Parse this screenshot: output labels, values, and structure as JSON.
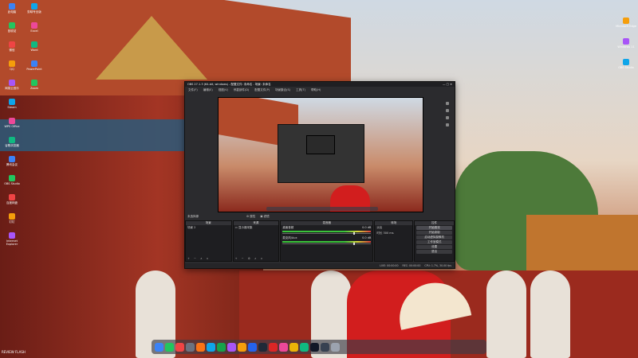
{
  "obs": {
    "title": "OBS 27.1.3 (64-bit, windows) - 配置文件: 未命名 - 场景: 未命名",
    "menu": [
      "文件(F)",
      "编辑(E)",
      "视图(V)",
      "停靠部件(D)",
      "配置文件(P)",
      "场景集合(S)",
      "工具(T)",
      "帮助(H)"
    ],
    "source_bar_label": "未选择源",
    "source_bar_props": "⚙ 属性",
    "source_bar_filters": "▣ 滤镜",
    "docks": {
      "scenes": {
        "title": "场景",
        "items": [
          "场景 2"
        ],
        "footer": "+ − ∧ ∨"
      },
      "sources": {
        "title": "来源",
        "items": [
          "显示器采集"
        ],
        "footer": "+ − ⚙ ∧ ∨"
      },
      "mixer": {
        "title": "混音器",
        "channels": [
          {
            "name": "桌面音频",
            "db": "0.0 dB",
            "level": 0.8
          },
          {
            "name": "麦克风/Aux",
            "db": "0.0 dB",
            "level": 0.8
          }
        ]
      },
      "transitions": {
        "title": "转场",
        "type": "淡出",
        "duration_label": "时长",
        "duration": "300 ms"
      },
      "controls": {
        "title": "控件",
        "buttons": [
          "开始推流",
          "开始录制",
          "启动虚拟摄像机",
          "工作室模式",
          "设置",
          "退出"
        ]
      }
    },
    "status": {
      "live": "LIVE: 00:00:00",
      "rec": "REC: 00:00:00",
      "cpu": "CPU: 1.7%, 30.00 fps"
    }
  },
  "taskbar": {
    "icons": [
      "finder-icon",
      "browser-icon",
      "chat-icon",
      "settings-icon",
      "music-icon",
      "mail-icon",
      "wechat-icon",
      "app-icon",
      "store-icon",
      "folder-icon",
      "steam-icon",
      "video-icon",
      "photo-icon",
      "calendar-icon",
      "notes-icon",
      "terminal-icon",
      "obs-icon",
      "trash-icon"
    ],
    "colors": [
      "#3b82f6",
      "#22c55e",
      "#ef4444",
      "#6b7280",
      "#f97316",
      "#0ea5e9",
      "#16a34a",
      "#a855f7",
      "#f59e0b",
      "#2563eb",
      "#1f2937",
      "#dc2626",
      "#ec4899",
      "#eab308",
      "#10b981",
      "#111827",
      "#374151",
      "#9ca3af"
    ]
  },
  "desktop": {
    "left_icons": [
      "此电脑",
      "回收站",
      "微信",
      "QQ",
      "网易云音乐",
      "Steam",
      "WPS Office",
      "谷歌浏览器",
      "腾讯会议",
      "OBS Studio",
      "百度网盘",
      "钉钉",
      "Internet Explorer",
      "剪映专业版",
      "Excel",
      "Word",
      "PowerPoint",
      "Zoom"
    ],
    "right_icons": [
      "Microsoft Edge",
      "Windows 11",
      "OBS Studio"
    ],
    "watermark": "REVIEW FLASH"
  },
  "accent": "#2b2b2e"
}
